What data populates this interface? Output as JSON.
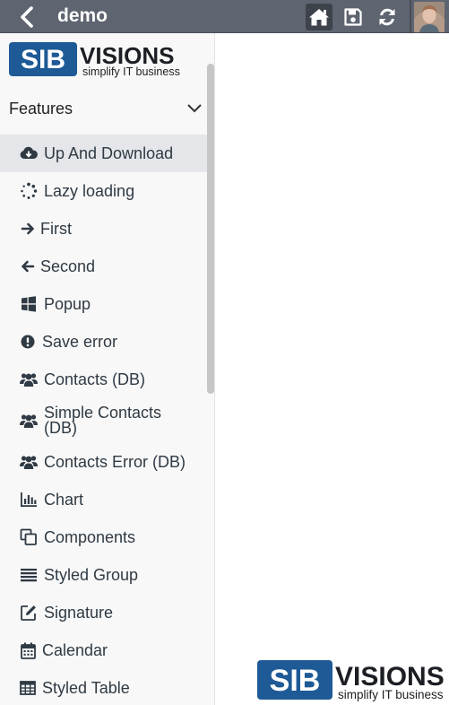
{
  "header": {
    "title": "demo",
    "colors": {
      "bar": "#5e6470",
      "active_button": "#3e434b"
    },
    "icons": [
      "chevron-left-icon",
      "home-icon",
      "save-icon",
      "refresh-icon"
    ]
  },
  "brand": {
    "logo_main_left": "SIB",
    "logo_main_right": "VISIONS",
    "logo_tagline": "simplify IT business",
    "colors": {
      "blue": "#1e5a96",
      "dark": "#1b1e23"
    }
  },
  "sidebar": {
    "section_title": "Features",
    "items": [
      {
        "label": "Up And Download",
        "icon": "cloud-download-icon",
        "active": true
      },
      {
        "label": "Lazy loading",
        "icon": "spinner-icon"
      },
      {
        "label": "First",
        "icon": "arrow-right-icon"
      },
      {
        "label": "Second",
        "icon": "arrow-left-icon"
      },
      {
        "label": "Popup",
        "icon": "windows-icon"
      },
      {
        "label": "Save error",
        "icon": "exclamation-circle-icon"
      },
      {
        "label": "Contacts (DB)",
        "icon": "users-icon"
      },
      {
        "label": "Simple Contacts (DB)",
        "icon": "users-icon"
      },
      {
        "label": "Contacts Error (DB)",
        "icon": "users-icon"
      },
      {
        "label": "Chart",
        "icon": "bar-chart-icon"
      },
      {
        "label": "Components",
        "icon": "clone-icon"
      },
      {
        "label": "Styled Group",
        "icon": "list-lines-icon"
      },
      {
        "label": "Signature",
        "icon": "pencil-square-icon"
      },
      {
        "label": "Calendar",
        "icon": "calendar-icon"
      },
      {
        "label": "Styled Table",
        "icon": "table-icon"
      }
    ]
  }
}
